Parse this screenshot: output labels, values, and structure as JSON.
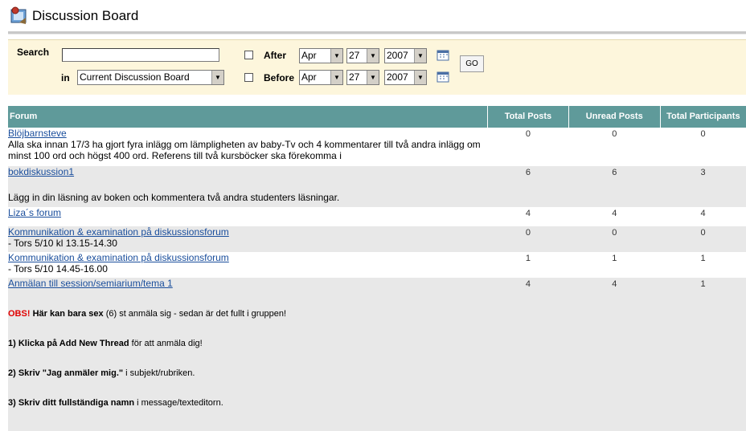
{
  "page": {
    "title": "Discussion Board"
  },
  "search": {
    "label": "Search",
    "in_label": "in",
    "value": "",
    "scope": "Current Discussion Board",
    "after_label": "After",
    "before_label": "Before",
    "after": {
      "month": "Apr",
      "day": "27",
      "year": "2007"
    },
    "before": {
      "month": "Apr",
      "day": "27",
      "year": "2007"
    },
    "go_label": "GO"
  },
  "table": {
    "headers": {
      "forum": "Forum",
      "total_posts": "Total Posts",
      "unread_posts": "Unread Posts",
      "total_participants": "Total Participants"
    },
    "rows": [
      {
        "name": "Blöjbarnsteve",
        "description": "Alla ska innan 17/3 ha gjort fyra inlägg om lämpligheten av baby-Tv och 4 kommentarer till två andra inlägg om minst 100 ord och högst 400 ord. Referens till två kursböcker ska förekomma i",
        "total": "0",
        "unread": "0",
        "participants": "0"
      },
      {
        "name": "bokdiskussion1",
        "description": "Lägg in din läsning av boken och kommentera två andra studenters läsningar.",
        "total": "6",
        "unread": "6",
        "participants": "3"
      },
      {
        "name": "Liza´s forum",
        "description": "",
        "total": "4",
        "unread": "4",
        "participants": "4"
      },
      {
        "name": "Kommunikation & examination på diskussionsforum",
        "description": "- Tors 5/10 kl 13.15-14.30",
        "total": "0",
        "unread": "0",
        "participants": "0"
      },
      {
        "name": "Kommunikation & examination på diskussionsforum",
        "description": "- Tors 5/10 14.45-16.00",
        "total": "1",
        "unread": "1",
        "participants": "1"
      },
      {
        "name": "Anmälan till session/semiarium/tema 1",
        "description": "",
        "total": "4",
        "unread": "4",
        "participants": "1"
      }
    ]
  },
  "notes": {
    "obs": "OBS!",
    "line1_bold": "Här kan bara sex",
    "line1_rest": "(6) st anmäla sig - sedan är det fullt i gruppen!",
    "step1_bold": "1) Klicka på Add New Thread",
    "step1_rest": "för att anmäla dig!",
    "step2_bold": "2) Skriv \"Jag anmäler mig.\"",
    "step2_rest": "i subjekt/rubriken.",
    "step3_bold": "3) Skriv ditt fullständiga namn",
    "step3_rest": "i message/texteditorn."
  },
  "colors": {
    "header_bg": "#5f9a9a",
    "search_bg": "#fdf6dc",
    "alt_row": "#e8e8e8",
    "link": "#1a4e9c",
    "obs": "#e00000"
  }
}
